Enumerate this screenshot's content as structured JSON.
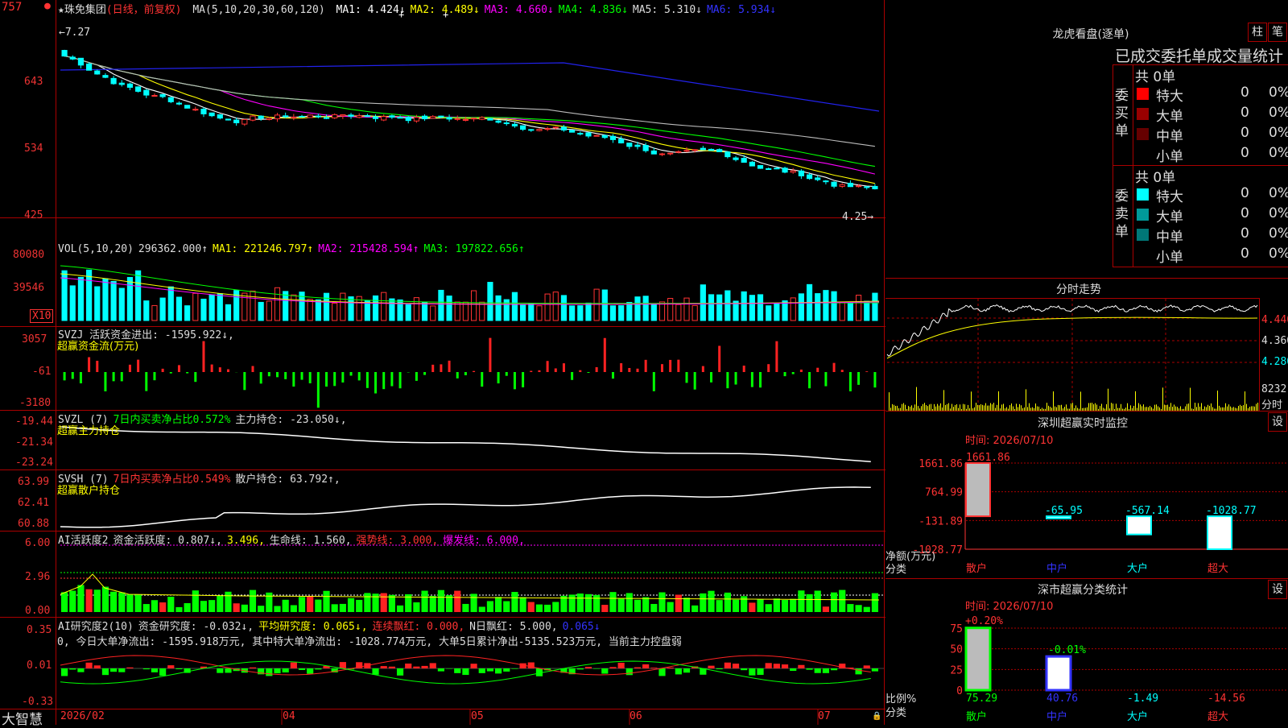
{
  "stock": {
    "name": "★珠免集团",
    "mode": "(日线，前复权)",
    "ma_label": "MA(5,10,20,30,60,120)",
    "ma_values": [
      {
        "label": "MA1: 4.424↓",
        "color": "#ffffff"
      },
      {
        "label": "MA2: 4.489↓",
        "color": "#ffff00"
      },
      {
        "label": "MA3: 4.660↓",
        "color": "#ff00ff"
      },
      {
        "label": "MA4: 4.836↓",
        "color": "#00ff00"
      },
      {
        "label": "MA5: 5.310↓",
        "color": "#dddddd"
      },
      {
        "label": "MA6: 5.934↓",
        "color": "#3333ff"
      }
    ],
    "high_marker": "←7.27",
    "low_marker": "4.25→",
    "axis": [
      "757",
      "643",
      "534",
      "425"
    ]
  },
  "vol": {
    "header": "VOL(5,10,20)",
    "value": "296362.000↑",
    "ma1": "MA1: 221246.797↑",
    "ma2": "MA2: 215428.594↑",
    "ma3": "MA3: 197822.656↑",
    "axis": [
      "80080",
      "39546"
    ],
    "unit": "X10"
  },
  "svzj": {
    "header": "SVZJ  活跃资金进出: -1595.922↓,",
    "subtitle": "超赢资金流(万元)",
    "axis": [
      "3057",
      "-61",
      "-3180"
    ]
  },
  "svzl": {
    "header": "SVZL (7)",
    "part2": "7日内买卖净占比0.572%",
    "part3": "主力持仓: -23.050↓,",
    "subtitle": "超赢主力持仓",
    "axis": [
      "-19.44",
      "-21.34",
      "-23.24"
    ]
  },
  "svsh": {
    "header": "SVSH (7)",
    "part2": "7日内买卖净占比0.549%",
    "part3": "散户持仓: 63.792↑,",
    "subtitle": "超赢散户持仓",
    "axis": [
      "63.99",
      "62.41",
      "60.88"
    ]
  },
  "ai1": {
    "header": "AI活跃度2",
    "part2": "资金活跃度: 0.807↓,",
    "part3": "3.496,",
    "part4": "生命线: 1.560,",
    "part5": "强势线: 3.000,",
    "part6": "爆发线: 6.000,",
    "axis": [
      "6.00",
      "2.96",
      "0.00"
    ]
  },
  "ai2": {
    "header": "AI研究度2(10)",
    "part2": "资金研究度: -0.032↓,",
    "part3": "平均研究度: 0.065↓,",
    "part4": "连续飘红: 0.000,",
    "part5": "N日飘红: 5.000,",
    "part6": "0.065↓",
    "line2": "0, 今日大单净流出: -1595.918万元, 其中特大单净流出: -1028.774万元, 大单5日累计净出-5135.523万元, 当前主力控盘弱",
    "axis": [
      "0.35",
      "0.01",
      "-0.33"
    ]
  },
  "xaxis": {
    "brand": "大智慧",
    "labels": [
      "2026/02",
      "04",
      "05",
      "06",
      "07"
    ]
  },
  "right": {
    "dragon_title": "龙虎看盘(逐单)",
    "btn_bar": "柱",
    "btn_pen": "笔",
    "order_title": "已成交委托单成交量统计",
    "buy_group": "委买单",
    "sell_group": "委卖单",
    "buy_total": "共 0单",
    "sell_total": "共 0单",
    "buy_rows": [
      {
        "label": "特大",
        "count": "0",
        "pct": "0%",
        "color": "#ff0000"
      },
      {
        "label": "大单",
        "count": "0",
        "pct": "0%",
        "color": "#990000"
      },
      {
        "label": "中单",
        "count": "0",
        "pct": "0%",
        "color": "#660000"
      },
      {
        "label": "小单",
        "count": "0",
        "pct": "0%",
        "color": ""
      }
    ],
    "sell_rows": [
      {
        "label": "特大",
        "count": "0",
        "pct": "0%",
        "color": "#00ffff"
      },
      {
        "label": "大单",
        "count": "0",
        "pct": "0%",
        "color": "#009999"
      },
      {
        "label": "中单",
        "count": "0",
        "pct": "0%",
        "color": "#007777"
      },
      {
        "label": "小单",
        "count": "0",
        "pct": "0%",
        "color": ""
      }
    ],
    "intraday_title": "分时走势",
    "intraday_axis": [
      "4.440",
      "4.360",
      "4.280"
    ],
    "intraday_vol": "8232",
    "intraday_unit": "分时",
    "sz_monitor_title": "深圳超赢实时监控",
    "sz_btn": "设",
    "sz_time": "时间: 2026/07/10",
    "sz_axis": [
      "1661.86",
      "764.99",
      "-131.89",
      "-1028.77"
    ],
    "sz_ylabel": "净额(万元)",
    "sz_xlabel": "分类",
    "sz_categories": [
      "散户",
      "中户",
      "大户",
      "超大"
    ],
    "sz_values": [
      "1661.86",
      "-65.95",
      "-567.14",
      "-1028.77"
    ],
    "sm_title": "深市超赢分类统计",
    "sm_btn": "设",
    "sm_time": "时间: 2026/07/10",
    "sm_axis": [
      "75",
      "50",
      "25",
      "0"
    ],
    "sm_top_labels": [
      "+0.20%",
      "-0.01%"
    ],
    "sm_ylabel": "比例%",
    "sm_xlabel": "分类",
    "sm_categories": [
      "散户",
      "中户",
      "大户",
      "超大"
    ],
    "sm_values": [
      "75.29",
      "40.76",
      "-1.49",
      "-14.56"
    ]
  },
  "chart_data": [
    {
      "type": "bar",
      "title": "深圳超赢实时监控",
      "categories": [
        "散户",
        "中户",
        "大户",
        "超大"
      ],
      "values": [
        1661.86,
        -65.95,
        -567.14,
        -1028.77
      ],
      "ylabel": "净额(万元)",
      "xlabel": "分类",
      "ylim": [
        -1028.77,
        1661.86
      ]
    },
    {
      "type": "bar",
      "title": "深市超赢分类统计",
      "categories": [
        "散户",
        "中户",
        "大户",
        "超大"
      ],
      "values": [
        75.29,
        40.76,
        -1.49,
        -14.56
      ],
      "ylabel": "比例%",
      "xlabel": "分类",
      "ylim": [
        0,
        75
      ]
    }
  ]
}
